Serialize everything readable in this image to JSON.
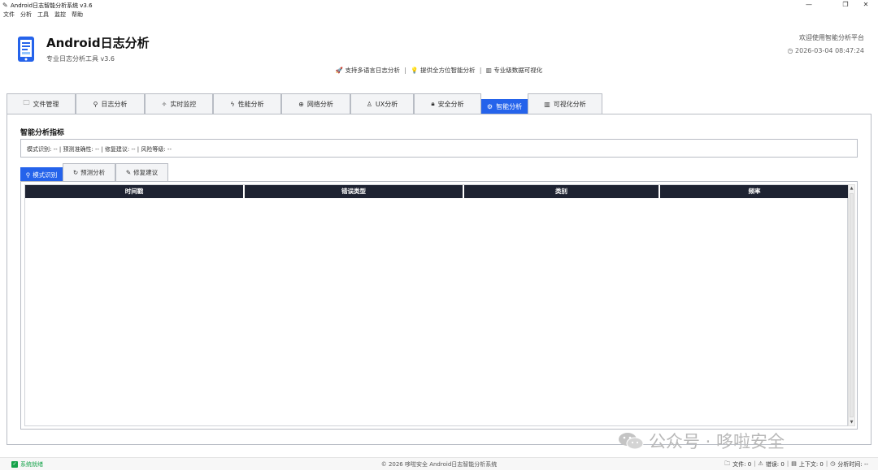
{
  "window": {
    "title": "Android日志智能分析系统 v3.6",
    "minimize": "—",
    "maximize": "❐",
    "close": "✕"
  },
  "menu": [
    "文件",
    "分析",
    "工具",
    "监控",
    "帮助"
  ],
  "header": {
    "title": "Android日志分析",
    "subtitle": "专业日志分析工具 v3.6",
    "welcome": "欢迎使用智能分析平台",
    "datetime": "2026-03-04 08:47:24",
    "features": [
      "支持多语言日志分析",
      "提供全方位智能分析",
      "专业级数据可视化"
    ]
  },
  "main_tabs": [
    {
      "label": "文件管理",
      "icon": "folder-icon"
    },
    {
      "label": "日志分析",
      "icon": "search-icon"
    },
    {
      "label": "实时监控",
      "icon": "monitor-icon"
    },
    {
      "label": "性能分析",
      "icon": "bolt-icon"
    },
    {
      "label": "网络分析",
      "icon": "globe-icon"
    },
    {
      "label": "UX分析",
      "icon": "user-icon"
    },
    {
      "label": "安全分析",
      "icon": "lock-icon"
    },
    {
      "label": "智能分析",
      "icon": "brain-icon",
      "active": true
    },
    {
      "label": "可视化分析",
      "icon": "chart-icon"
    }
  ],
  "section": {
    "title": "智能分析指标",
    "metrics": "模式识别: -- | 预测准确性: -- | 修复建议: -- | 风险等级: --"
  },
  "sub_tabs": [
    {
      "label": "模式识别",
      "icon": "search-icon",
      "active": true
    },
    {
      "label": "预测分析",
      "icon": "refresh-icon"
    },
    {
      "label": "修复建议",
      "icon": "pencil-icon"
    }
  ],
  "table": {
    "columns": [
      "时间戳",
      "错误类型",
      "类别",
      "频率"
    ]
  },
  "watermark": "公众号 · 哆啦安全",
  "status": {
    "left": "系统就绪",
    "center": "© 2026 哆啦安全 Android日志智能分析系统",
    "files": "文件: 0",
    "errors": "错误: 0",
    "context": "上下文: 0",
    "analysis_time": "分析时间: --"
  },
  "colors": {
    "accent": "#2563eb",
    "table_header": "#1e2332",
    "status_ok": "#16a34a"
  }
}
